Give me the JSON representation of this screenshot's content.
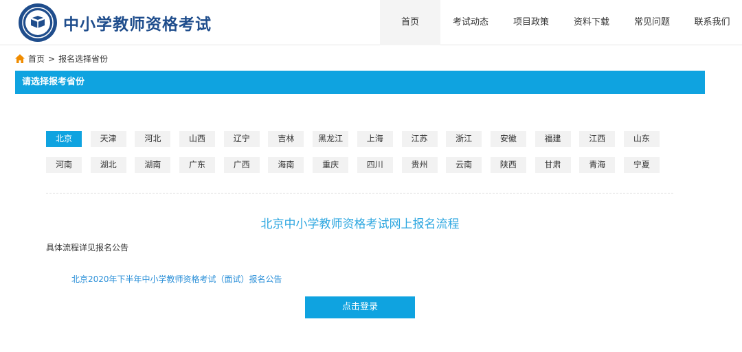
{
  "header": {
    "site_title": "中小学教师资格考试",
    "logo_icon": "exam-emblem-icon",
    "nav": [
      {
        "label": "首页",
        "active": true
      },
      {
        "label": "考试动态"
      },
      {
        "label": "项目政策"
      },
      {
        "label": "资料下载"
      },
      {
        "label": "常见问题"
      },
      {
        "label": "联系我们"
      }
    ]
  },
  "breadcrumb": {
    "home_icon": "home-icon",
    "home": "首页",
    "separator": ">",
    "current": "报名选择省份"
  },
  "section": {
    "title": "请选择报考省份"
  },
  "provinces": {
    "row1": [
      "北京",
      "天津",
      "河北",
      "山西",
      "辽宁",
      "吉林",
      "黑龙江",
      "上海",
      "江苏",
      "浙江",
      "安徽",
      "福建",
      "江西",
      "山东"
    ],
    "row2": [
      "河南",
      "湖北",
      "湖南",
      "广东",
      "广西",
      "海南",
      "重庆",
      "四川",
      "贵州",
      "云南",
      "陕西",
      "甘肃",
      "青海",
      "宁夏"
    ],
    "selected": "北京"
  },
  "content": {
    "flow_title": "北京中小学教师资格考试网上报名流程",
    "detail_text": "具体流程详见报名公告",
    "notice_link": "北京2020年下半年中小学教师资格考试（面试）报名公告",
    "login_button": "点击登录"
  },
  "colors": {
    "accent": "#0fa3e0",
    "title_blue": "#1f4d8c",
    "link_blue": "#2a8fd8"
  }
}
